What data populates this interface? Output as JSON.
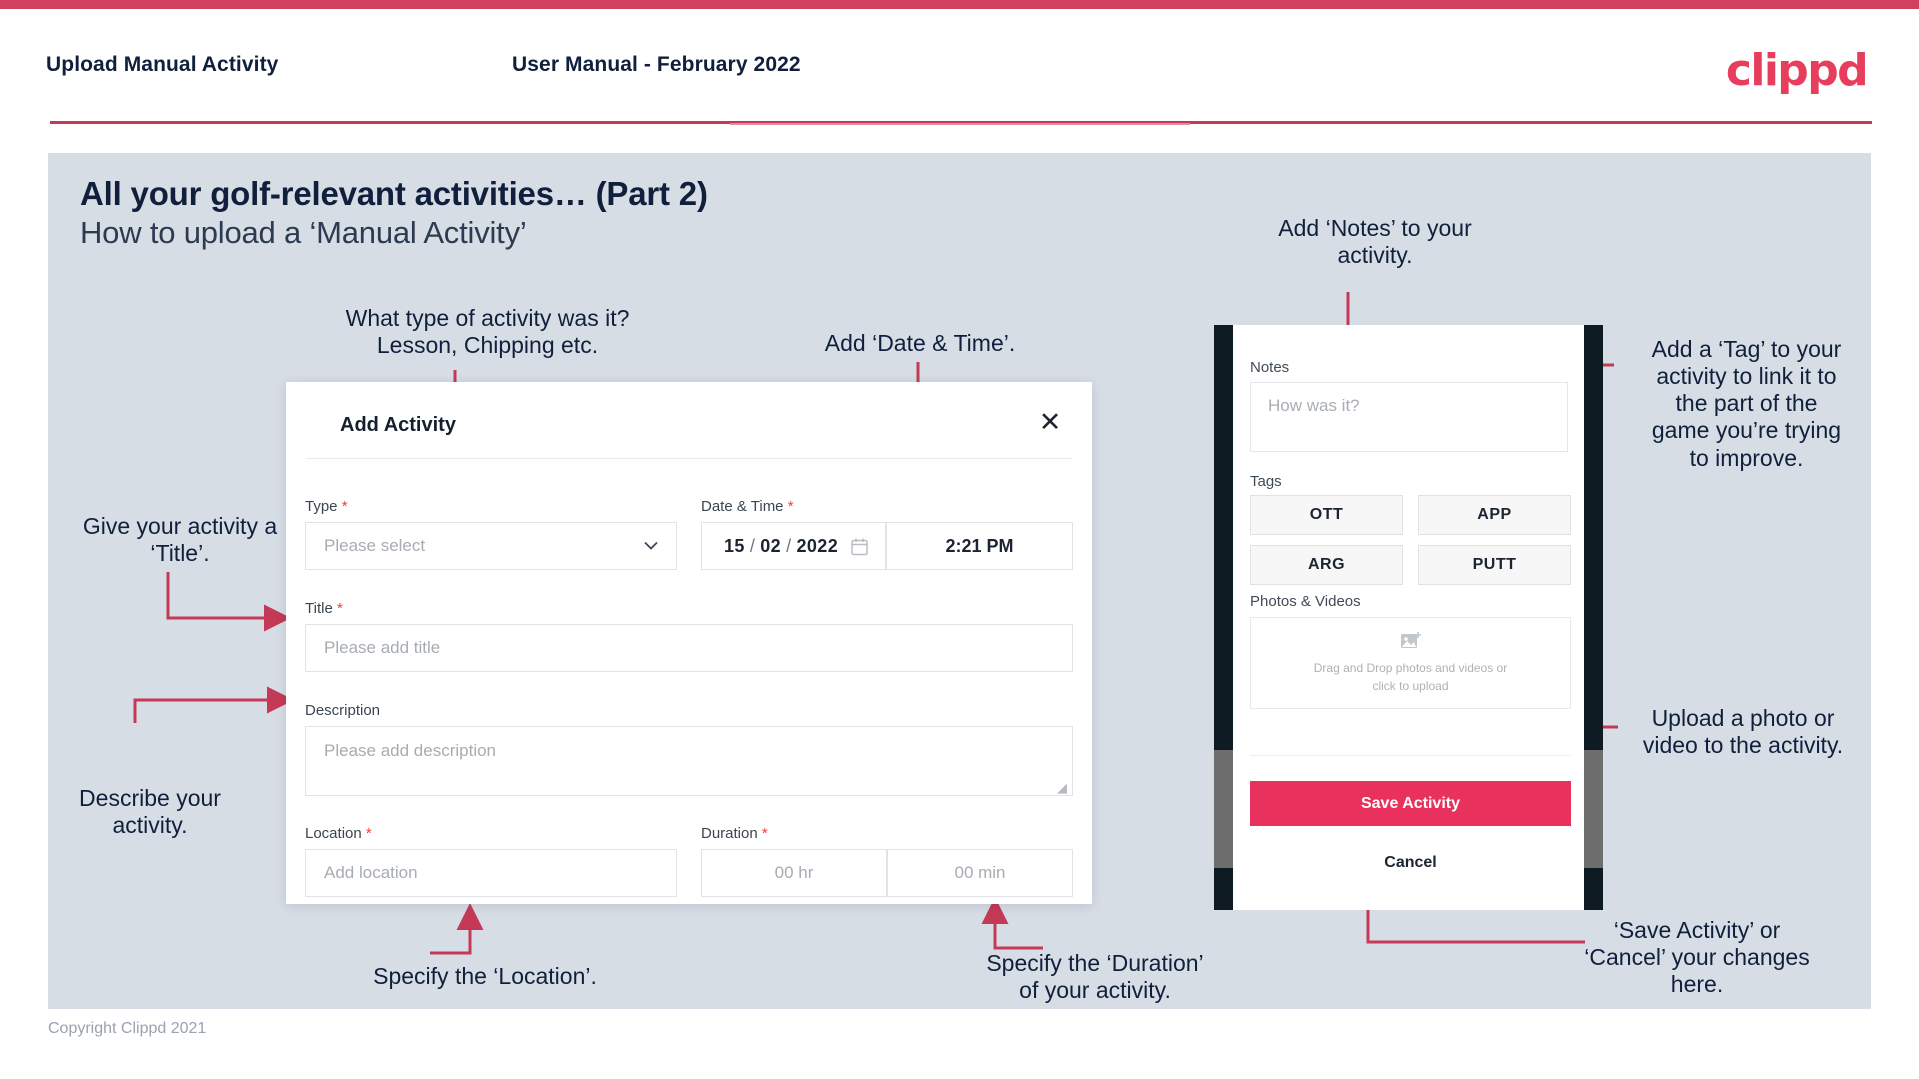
{
  "header": {
    "left_title": "Upload Manual Activity",
    "center_title": "User Manual - February 2022",
    "logo": "clippd"
  },
  "slide": {
    "title": "All your golf-relevant activities… (Part 2)",
    "subtitle": "How to upload a ‘Manual Activity’"
  },
  "footer": {
    "copyright": "Copyright Clippd 2021"
  },
  "colors": {
    "accent": "#d1405e",
    "brand": "#e83e5e",
    "save_button": "#e8315c",
    "slide_background": "#d7dde5",
    "required_star": "#e8433f",
    "connector": "#c43a56"
  },
  "dialog": {
    "title": "Add Activity",
    "close_icon": "close-icon",
    "fields": {
      "type": {
        "label": "Type",
        "required": "*",
        "placeholder": "Please select",
        "chevron": "chevron-down-icon"
      },
      "datetime": {
        "label": "Date & Time",
        "required": "*",
        "day": "15",
        "sep1": "/",
        "month": "02",
        "sep2": "/",
        "year": "2022",
        "calendar_icon": "calendar-icon",
        "time": "2:21 PM"
      },
      "title": {
        "label": "Title",
        "required": "*",
        "placeholder": "Please add title"
      },
      "description": {
        "label": "Description",
        "required": "",
        "placeholder": "Please add description"
      },
      "location": {
        "label": "Location",
        "required": "*",
        "placeholder": "Add location"
      },
      "duration": {
        "label": "Duration",
        "required": "*",
        "hours": "00 hr",
        "minutes": "00 min"
      }
    }
  },
  "mobile": {
    "notes_label": "Notes",
    "notes_placeholder": "How was it?",
    "tags_label": "Tags",
    "tags": [
      "OTT",
      "APP",
      "ARG",
      "PUTT"
    ],
    "photos_label": "Photos & Videos",
    "dropzone_icon": "add-image-icon",
    "dropzone_line1": "Drag and Drop photos and videos or",
    "dropzone_line2": "click to upload",
    "save_label": "Save Activity",
    "cancel_label": "Cancel"
  },
  "annotations": {
    "type": "What type of activity was it?\nLesson, Chipping etc.",
    "datetime": "Add ‘Date & Time’.",
    "notes": "Add ‘Notes’ to your\nactivity.",
    "tag": "Add a ‘Tag’ to your\nactivity to link it to\nthe part of the\ngame you’re trying\nto improve.",
    "title": "Give your activity a\n‘Title’.",
    "description": "Describe your\nactivity.",
    "location": "Specify the ‘Location’.",
    "duration": "Specify the ‘Duration’\nof your activity.",
    "upload": "Upload a photo or\nvideo to the activity.",
    "save": "‘Save Activity’ or\n‘Cancel’ your changes\nhere."
  }
}
